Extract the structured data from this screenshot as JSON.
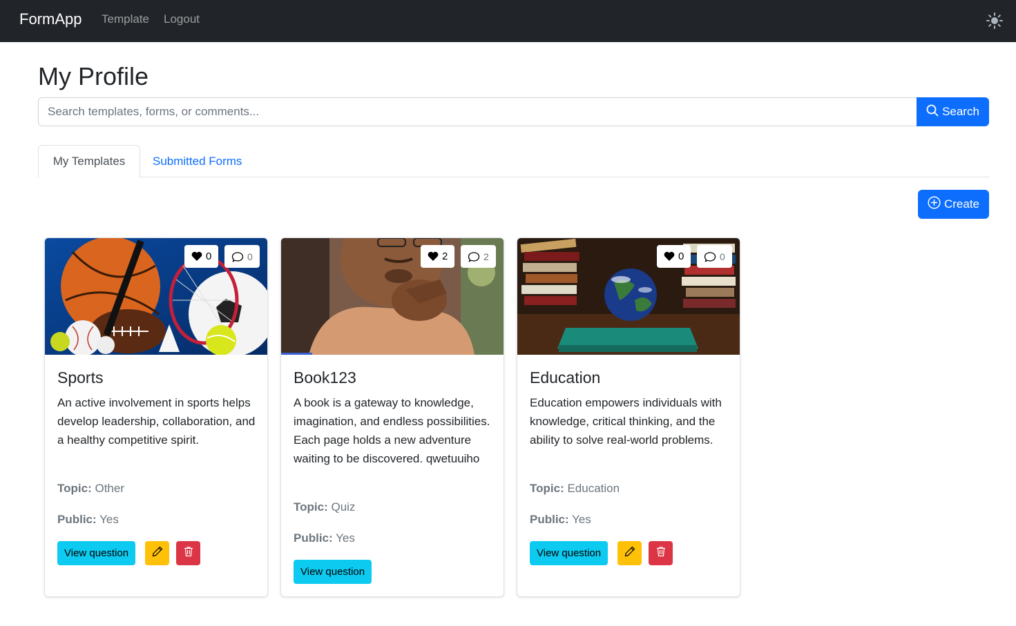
{
  "navbar": {
    "brand": "FormApp",
    "links": [
      "Template",
      "Logout"
    ],
    "theme_icon": "sun-icon"
  },
  "page": {
    "title": "My Profile"
  },
  "search": {
    "placeholder": "Search templates, forms, or comments...",
    "value": "",
    "button_label": "Search"
  },
  "tabs": [
    {
      "label": "My Templates",
      "active": true
    },
    {
      "label": "Submitted Forms",
      "active": false
    }
  ],
  "create_label": "Create",
  "meta_labels": {
    "topic": "Topic:",
    "public": "Public:"
  },
  "cards": [
    {
      "title": "Sports",
      "image": "sports-equipment-image",
      "likes": "0",
      "comments": "0",
      "description": "An active involvement in sports helps develop leadership, collaboration, and a healthy competitive spirit.",
      "topic": "Other",
      "public": "Yes",
      "view_label": "View question",
      "editable": true
    },
    {
      "title": "Book123",
      "image": "man-thinking-image",
      "likes": "2",
      "comments": "2",
      "description": "A book is a gateway to knowledge, imagination, and endless possibilities. Each page holds a new adventure waiting to be discovered. qwetuuiho",
      "topic": "Quiz",
      "public": "Yes",
      "view_label": "View question",
      "editable": false
    },
    {
      "title": "Education",
      "image": "globe-on-books-image",
      "likes": "0",
      "comments": "0",
      "description": "Education empowers individuals with knowledge, critical thinking, and the ability to solve real-world problems.",
      "topic": "Education",
      "public": "Yes",
      "view_label": "View question",
      "editable": true
    }
  ],
  "colors": {
    "navbar_bg": "#212529",
    "primary": "#0d6efd",
    "info": "#0dcaf0",
    "warning": "#ffc107",
    "danger": "#dc3545"
  }
}
